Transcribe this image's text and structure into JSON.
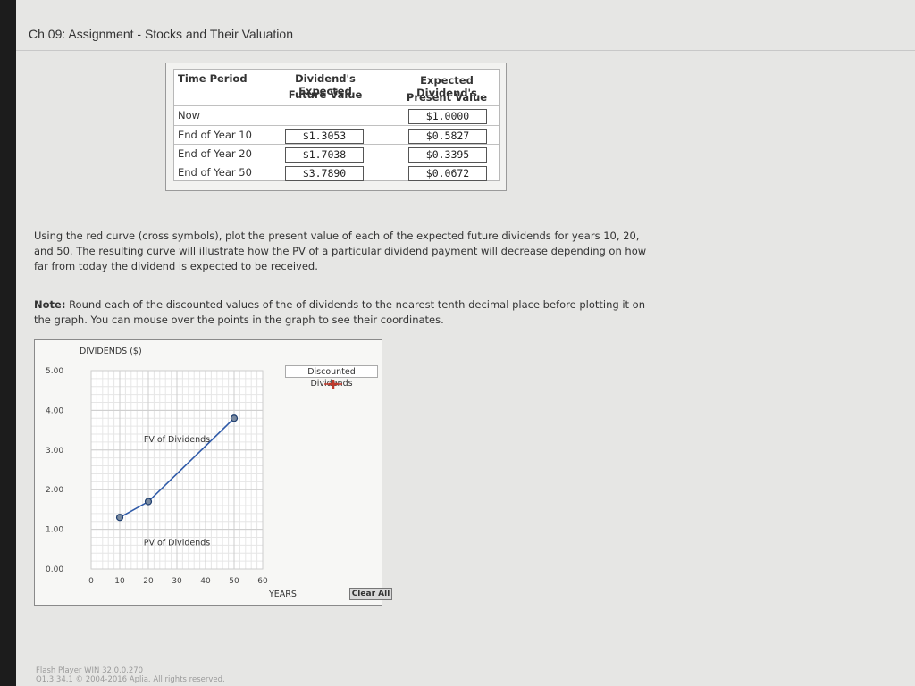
{
  "page": {
    "title": "Ch 09: Assignment - Stocks and Their Valuation"
  },
  "table": {
    "headers": {
      "period": "Time Period",
      "fv_line1": "Dividend's Expected",
      "fv_line2": "Future Value",
      "pv_line1": "Expected Dividend's",
      "pv_line2": "Present Value"
    },
    "rows": [
      {
        "period": "Now",
        "fv": "",
        "pv": "$1.0000"
      },
      {
        "period": "End of Year 10",
        "fv": "$1.3053",
        "pv": "$0.5827"
      },
      {
        "period": "End of Year 20",
        "fv": "$1.7038",
        "pv": "$0.3395"
      },
      {
        "period": "End of Year 50",
        "fv": "$3.7890",
        "pv": "$0.0672"
      }
    ]
  },
  "instructions": {
    "text": "Using the red curve (cross symbols), plot the present value of each of the expected future dividends for years 10, 20, and 50. The resulting curve will illustrate how the PV of a particular dividend payment will decrease depending on how far from today the dividend is expected to be received."
  },
  "note": {
    "label": "Note:",
    "text": " Round each of the discounted values of the of dividends to the nearest tenth decimal place before plotting it on the graph. You can mouse over the points in the graph to see their coordinates."
  },
  "chart_data": {
    "type": "line",
    "ylabel": "DIVIDENDS ($)",
    "xlabel": "YEARS",
    "xlim": [
      0,
      60
    ],
    "ylim": [
      0,
      5
    ],
    "x_ticks": [
      "0",
      "10",
      "20",
      "30",
      "40",
      "50",
      "60"
    ],
    "y_ticks": [
      "0.00",
      "1.00",
      "2.00",
      "3.00",
      "4.00",
      "5.00"
    ],
    "grid": true,
    "series": [
      {
        "name": "FV of Dividends",
        "color": "#2f5aa8",
        "marker": "circle",
        "points": [
          {
            "x": 10,
            "y": 1.3
          },
          {
            "x": 20,
            "y": 1.7
          },
          {
            "x": 50,
            "y": 3.8
          }
        ]
      }
    ],
    "annotations": [
      {
        "text": "FV of Dividends",
        "x": 30,
        "y": 3.2
      },
      {
        "text": "PV of Dividends",
        "x": 30,
        "y": 0.6
      }
    ],
    "legend": {
      "label": "Discounted Dividends",
      "placement": "top-right",
      "color": "#c0392b",
      "marker": "cross"
    }
  },
  "controls": {
    "clear_label": "Clear All"
  },
  "footer": {
    "line1": "Flash Player WIN 32,0,0,270",
    "line2": "Q1.3.34.1 © 2004-2016 Aplia. All rights reserved."
  }
}
